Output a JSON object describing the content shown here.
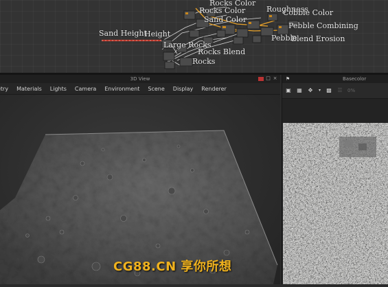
{
  "graph": {
    "labels": [
      {
        "id": "rocks-color-1",
        "text": "Rocks Color"
      },
      {
        "id": "roughness",
        "text": "Roughness"
      },
      {
        "id": "rocks-color-2",
        "text": "Rocks Color"
      },
      {
        "id": "cobble-color",
        "text": "Cobble Color"
      },
      {
        "id": "sand-color",
        "text": "Sand Color"
      },
      {
        "id": "pebble-combining",
        "text": "Pebble Combining"
      },
      {
        "id": "sand-height",
        "text": "Sand Height"
      },
      {
        "id": "blend-erosion",
        "text": "Blend Erosion"
      },
      {
        "id": "large-rocks",
        "text": "Large Rocks"
      },
      {
        "id": "rocks-blend",
        "text": "Rocks Blend"
      },
      {
        "id": "rocks",
        "text": "Rocks"
      },
      {
        "id": "height",
        "text": "Height"
      },
      {
        "id": "pebble",
        "text": "Pebble"
      }
    ]
  },
  "view3d": {
    "title": "3D View",
    "menu": [
      "etry",
      "Materials",
      "Lights",
      "Camera",
      "Environment",
      "Scene",
      "Display",
      "Renderer"
    ]
  },
  "view2d": {
    "title": "Basecolor",
    "zoom_field": "0%"
  },
  "watermark": "CG88.CN 享你所想",
  "colors": {
    "accent_orange": "#c9871b",
    "selection_red": "#c0392b",
    "watermark": "#f0b21e"
  }
}
